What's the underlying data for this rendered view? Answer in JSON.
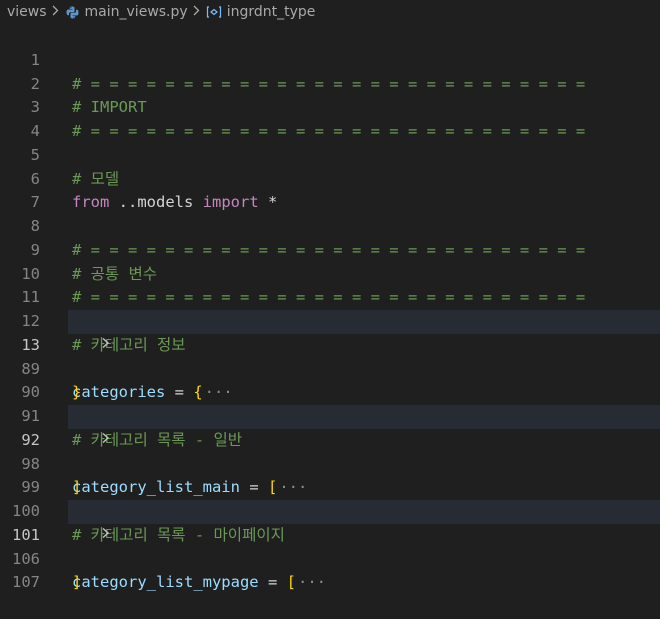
{
  "breadcrumb": {
    "folder": "views",
    "file": "main_views.py",
    "symbol": "ingrdnt_type"
  },
  "editor": {
    "lines": [
      {
        "num": "1",
        "comment": "# = = = = = = = = = = = = = = = = = = = = = = = = = = ="
      },
      {
        "num": "2",
        "comment": "# IMPORT"
      },
      {
        "num": "3",
        "comment": "# = = = = = = = = = = = = = = = = = = = = = = = = = = ="
      },
      {
        "num": "4"
      },
      {
        "num": "5",
        "comment": "# 모델"
      },
      {
        "num": "6",
        "kw1": "from",
        "mid": " ..models ",
        "kw2": "import",
        "rest": " *"
      },
      {
        "num": "7"
      },
      {
        "num": "8",
        "comment": "# = = = = = = = = = = = = = = = = = = = = = = = = = = ="
      },
      {
        "num": "9",
        "comment": "# 공통 변수"
      },
      {
        "num": "10",
        "comment": "# = = = = = = = = = = = = = = = = = = = = = = = = = = ="
      },
      {
        "num": "11"
      },
      {
        "num": "12",
        "comment": "# 카테고리 정보"
      },
      {
        "num": "13",
        "var": "categories",
        "op": " = ",
        "bracket": "{",
        "ellipsis": "···"
      },
      {
        "num": "89",
        "bracket": "}"
      },
      {
        "num": "90"
      },
      {
        "num": "91",
        "comment": "# 카테고리 목록 - 일반"
      },
      {
        "num": "92",
        "var": "category_list_main",
        "op": " = ",
        "bracket": "[",
        "ellipsis": "···"
      },
      {
        "num": "98",
        "bracket": "]"
      },
      {
        "num": "99"
      },
      {
        "num": "100",
        "comment": "# 카테고리 목록 - 마이페이지"
      },
      {
        "num": "101",
        "var": "category_list_mypage",
        "op": " = ",
        "bracket": "[",
        "ellipsis": "···"
      },
      {
        "num": "106",
        "bracket": "]"
      },
      {
        "num": "107"
      }
    ]
  },
  "colors": {
    "background": "#1f1f1f",
    "comment": "#6a9955",
    "keyword": "#c586c0",
    "variable": "#9cdcfe",
    "bracket": "#ffd700",
    "line_number": "#858585",
    "folded_line_highlight": "#272b33"
  },
  "icons": {
    "separator": "chevron-right-icon",
    "file": "python-file-icon",
    "symbol": "variable-symbol-icon",
    "fold": "fold-chevron-right-icon"
  }
}
